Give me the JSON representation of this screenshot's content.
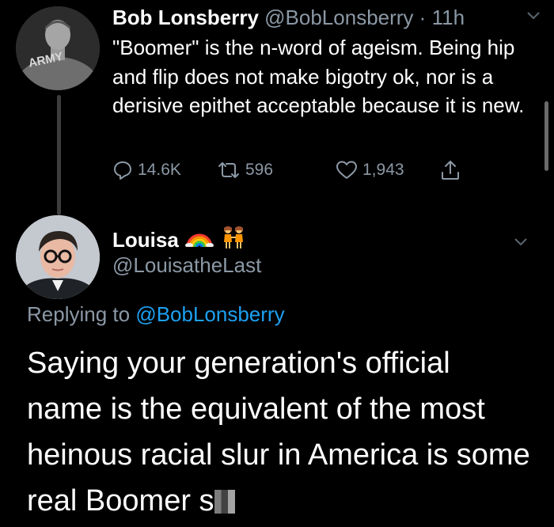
{
  "tweet1": {
    "name": "Bob Lonsberry",
    "handle": "@BobLonsberry",
    "separator": "·",
    "time": "11h",
    "avatar_patch_text": "ARMY",
    "text": "\"Boomer\" is the n-word of ageism. Being hip and flip does not make bigotry ok, nor is a derisive epithet acceptable because it is new.",
    "replies": "14.6K",
    "retweets": "596",
    "likes": "1,943"
  },
  "tweet2": {
    "name": "Louisa",
    "emoji_icons": [
      "rainbow-icon",
      "two-women-holding-hands-icon"
    ],
    "handle": "@LouisatheLast",
    "replying_prefix": "Replying to",
    "replying_mention": "@BobLonsberry",
    "text": "Saying your generation's official name is the equivalent of the most heinous racial slur in America is some real Boomer s"
  },
  "colors": {
    "background": "#000000",
    "secondary_text": "#8b98a5",
    "link": "#1da1f2"
  }
}
